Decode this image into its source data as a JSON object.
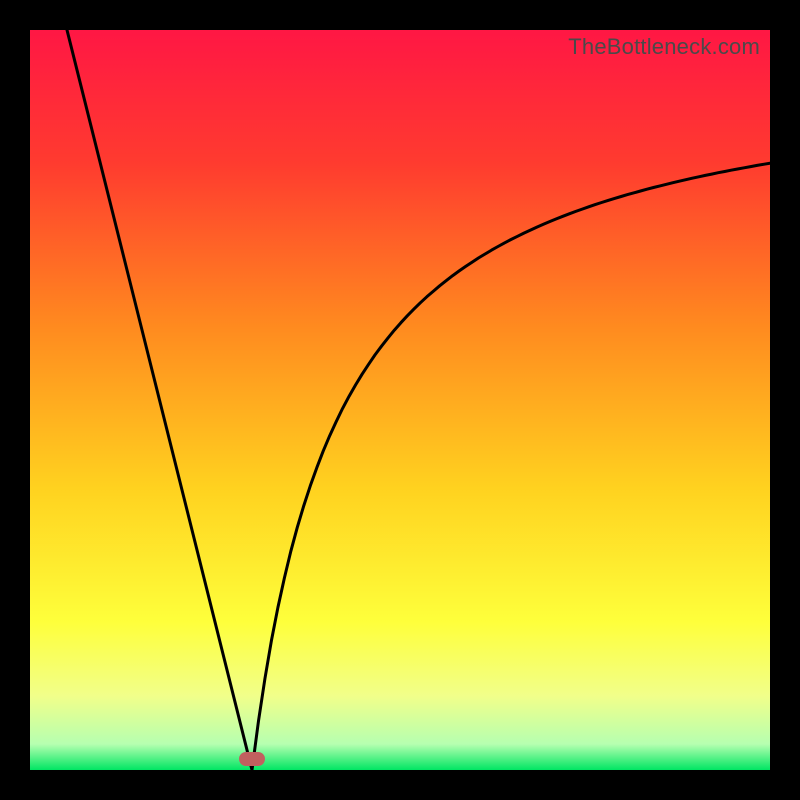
{
  "watermark": "TheBottleneck.com",
  "chart_data": {
    "type": "line",
    "title": "",
    "xlabel": "",
    "ylabel": "",
    "xlim": [
      0,
      100
    ],
    "ylim": [
      0,
      100
    ],
    "grid": false,
    "legend": false,
    "background_gradient_stops": [
      {
        "offset": 0.0,
        "color": "#ff1744"
      },
      {
        "offset": 0.18,
        "color": "#ff3b2f"
      },
      {
        "offset": 0.4,
        "color": "#ff8a1f"
      },
      {
        "offset": 0.62,
        "color": "#ffd21f"
      },
      {
        "offset": 0.8,
        "color": "#feff3b"
      },
      {
        "offset": 0.9,
        "color": "#f1ff8a"
      },
      {
        "offset": 0.965,
        "color": "#b6ffb0"
      },
      {
        "offset": 1.0,
        "color": "#00e663"
      }
    ],
    "curve": {
      "description": "V-shaped bottleneck curve: steep linear descent from top-left to the optimum, then asymptotic rise toward the right.",
      "left_top_point": {
        "x": 5,
        "y": 100
      },
      "optimum_point": {
        "x": 30,
        "y": 0
      },
      "right_end_point": {
        "x": 100,
        "y": 82
      }
    },
    "marker": {
      "x": 30,
      "y": 1.5,
      "color": "#c1605f"
    }
  }
}
